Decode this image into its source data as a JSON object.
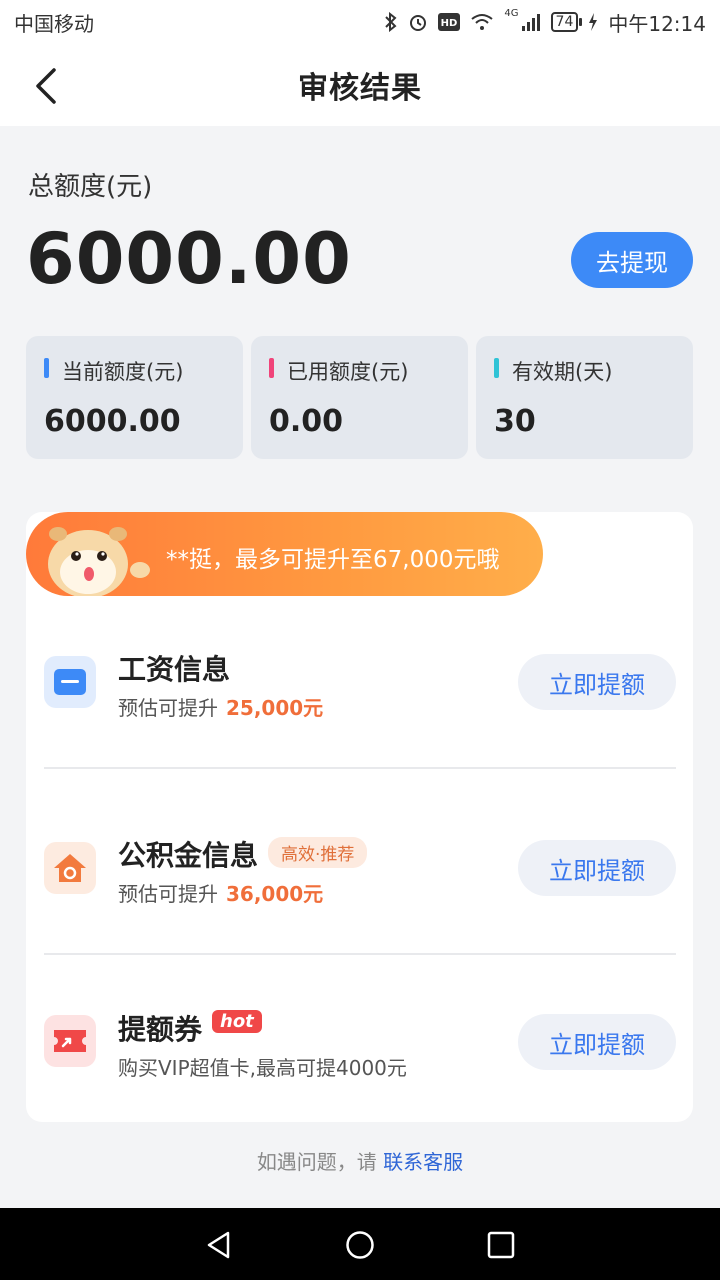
{
  "status_bar": {
    "carrier": "中国移动",
    "network": "4G",
    "battery": "74",
    "time": "中午12:14"
  },
  "header": {
    "title": "审核结果"
  },
  "summary": {
    "total_label": "总额度(元)",
    "total_amount": "6000.00",
    "withdraw_label": "去提现",
    "stats": [
      {
        "label": "当前额度(元)",
        "value": "6000.00",
        "color": "#3d8af7"
      },
      {
        "label": "已用额度(元)",
        "value": "0.00",
        "color": "#f0447a"
      },
      {
        "label": "有效期(天)",
        "value": "30",
        "color": "#2fc3d6"
      }
    ]
  },
  "promo": {
    "text": "**挺，最多可提升至67,000元哦"
  },
  "items": [
    {
      "title": "工资信息",
      "sub_prefix": "预估可提升",
      "sub_amount": "25,000元",
      "button": "立即提额",
      "icon": "card-icon"
    },
    {
      "title": "公积金信息",
      "tag": "高效·推荐",
      "sub_prefix": "预估可提升",
      "sub_amount": "36,000元",
      "button": "立即提额",
      "icon": "house-icon"
    },
    {
      "title": "提额券",
      "tag": "hot",
      "sub_prefix": "购买VIP超值卡,最高可提4000元",
      "button": "立即提额",
      "icon": "ticket-icon"
    }
  ],
  "footer": {
    "text": "如遇问题，请",
    "link": "联系客服"
  },
  "colors": {
    "accent": "#3d8af7",
    "orange": "#f06e3a",
    "hot": "#f04848"
  }
}
